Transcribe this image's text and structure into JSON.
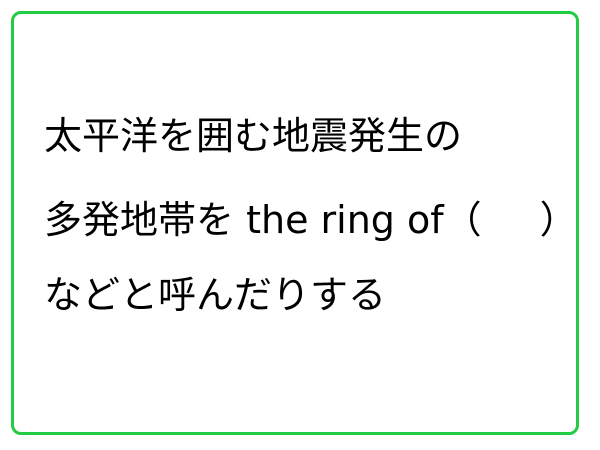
{
  "quiz": {
    "line1": "太平洋を囲む地震発生の",
    "line2_before_blank": "多発地帯を the ring of（",
    "line2_after_blank": "）",
    "line3": "などと呼んだりする"
  },
  "colors": {
    "border": "#22cc44",
    "text": "#000000",
    "background": "#ffffff"
  }
}
